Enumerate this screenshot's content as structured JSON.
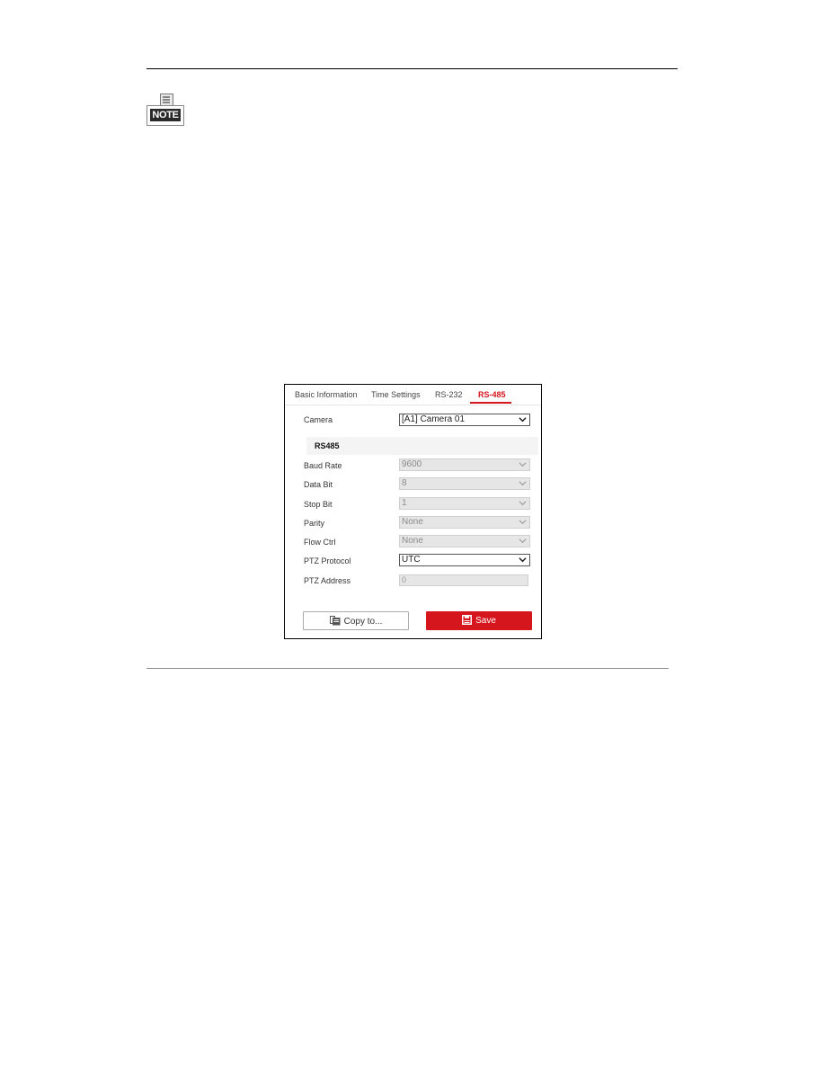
{
  "page": {
    "note_icon_label": "NOTE"
  },
  "panel": {
    "tabs": [
      {
        "label": "Basic Information",
        "active": false
      },
      {
        "label": "Time Settings",
        "active": false
      },
      {
        "label": "RS-232",
        "active": false
      },
      {
        "label": "RS-485",
        "active": true
      }
    ],
    "accent_color": "#d6161d",
    "camera": {
      "label": "Camera",
      "value": "[A1] Camera 01"
    },
    "section_title": "RS485",
    "fields": [
      {
        "label": "Baud Rate",
        "value": "9600",
        "disabled": true,
        "type": "select"
      },
      {
        "label": "Data Bit",
        "value": "8",
        "disabled": true,
        "type": "select"
      },
      {
        "label": "Stop Bit",
        "value": "1",
        "disabled": true,
        "type": "select"
      },
      {
        "label": "Parity",
        "value": "None",
        "disabled": true,
        "type": "select"
      },
      {
        "label": "Flow Ctrl",
        "value": "None",
        "disabled": true,
        "type": "select"
      },
      {
        "label": "PTZ Protocol",
        "value": "UTC",
        "disabled": false,
        "type": "select"
      },
      {
        "label": "PTZ Address",
        "value": "0",
        "disabled": true,
        "type": "input"
      }
    ],
    "buttons": {
      "copy_label": "Copy to...",
      "copy_icon": "copy-icon",
      "save_label": "Save",
      "save_icon": "floppy-disk-icon"
    }
  }
}
